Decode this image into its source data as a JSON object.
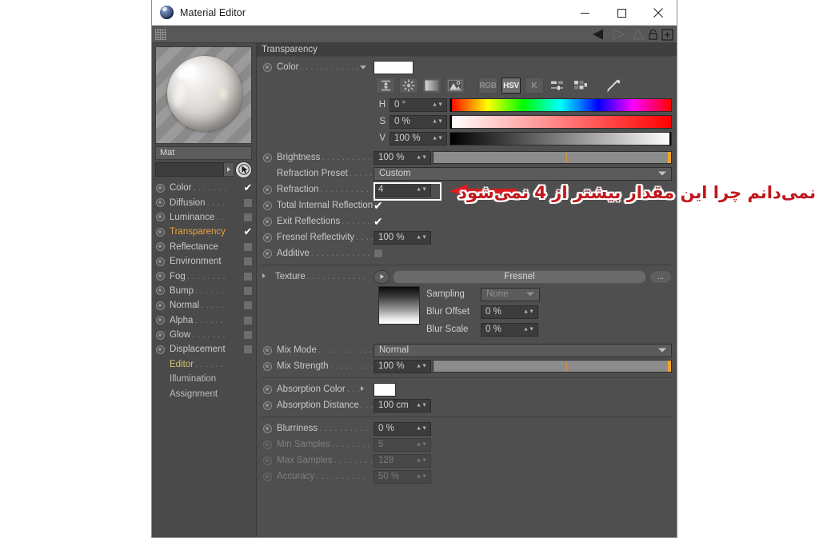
{
  "window": {
    "title": "Material Editor",
    "icon": "material-sphere-icon",
    "minimize_label": "─",
    "maximize_label": "□",
    "close_label": "✕"
  },
  "toolstrip": {
    "grip": "drag-grip",
    "icons": [
      "back-arrow-icon",
      "forward-arrow-icon",
      "up-arrow-icon",
      "lock-icon",
      "add-panel-icon"
    ]
  },
  "sidebar": {
    "material_name": "Mat",
    "name_field_value": "",
    "channels": [
      {
        "label": "Color",
        "dots": ". . . . . . .",
        "state": "checked",
        "active": false
      },
      {
        "label": "Diffusion",
        "dots": ". . . .",
        "state": "box",
        "active": false
      },
      {
        "label": "Luminance",
        "dots": ". .",
        "state": "box",
        "active": false
      },
      {
        "label": "Transparency",
        "dots": "",
        "state": "checked",
        "active": true
      },
      {
        "label": "Reflectance",
        "dots": "",
        "state": "box",
        "active": false
      },
      {
        "label": "Environment",
        "dots": "",
        "state": "box",
        "active": false
      },
      {
        "label": "Fog",
        "dots": ". . . . . . . .",
        "state": "box",
        "active": false
      },
      {
        "label": "Bump",
        "dots": ". . . . . .",
        "state": "box",
        "active": false
      },
      {
        "label": "Normal",
        "dots": ". . . . .",
        "state": "box",
        "active": false
      },
      {
        "label": "Alpha",
        "dots": ". . . . . .",
        "state": "box",
        "active": false
      },
      {
        "label": "Glow",
        "dots": ". . . . . . .",
        "state": "box",
        "active": false
      },
      {
        "label": "Displacement",
        "dots": "",
        "state": "box",
        "active": false
      }
    ],
    "extras": [
      {
        "label": "Editor",
        "dots": ". . . . . .",
        "highlight": true
      },
      {
        "label": "Illumination",
        "dots": "",
        "highlight": false
      },
      {
        "label": "Assignment",
        "dots": "",
        "highlight": false
      }
    ]
  },
  "panel": {
    "section_title": "Transparency",
    "color": {
      "label": "Color",
      "dots": ". . . . . . . . . . . .",
      "swatch": "#ffffff",
      "tools": [
        {
          "name": "eyedrop-range-icon",
          "glyph": "⧉",
          "type": "icon",
          "selected": false
        },
        {
          "name": "color-wheel-icon",
          "glyph": "✳",
          "type": "icon",
          "selected": false
        },
        {
          "name": "gradient-icon",
          "glyph": "",
          "type": "icon",
          "selected": false
        },
        {
          "name": "image-picker-icon",
          "glyph": "",
          "type": "icon",
          "selected": false
        },
        {
          "name": "rgb-mode-button",
          "glyph": "RGB",
          "type": "mode",
          "selected": false
        },
        {
          "name": "hsv-mode-button",
          "glyph": "HSV",
          "type": "mode",
          "selected": true
        },
        {
          "name": "k-mode-button",
          "glyph": "K",
          "type": "mode",
          "selected": false
        },
        {
          "name": "sliders-icon",
          "glyph": "",
          "type": "icon",
          "selected": false
        },
        {
          "name": "swatches-icon",
          "glyph": "",
          "type": "icon",
          "selected": false
        },
        {
          "name": "eyedropper-icon",
          "glyph": "",
          "type": "icon",
          "selected": false
        }
      ],
      "hsv": [
        {
          "key": "H",
          "value": "0 °",
          "bar": "hue",
          "marker_pct": 0
        },
        {
          "key": "S",
          "value": "0 %",
          "bar": "saturation",
          "marker_pct": 0
        },
        {
          "key": "V",
          "value": "100 %",
          "bar": "value",
          "marker_pct": 100
        }
      ]
    },
    "brightness": {
      "label": "Brightness",
      "dots": ". . . . . . . . . .",
      "value": "100 %",
      "slider_pct": 100
    },
    "refraction_preset": {
      "label": "Refraction Preset",
      "dots": ". . . . . .",
      "value": "Custom"
    },
    "refraction": {
      "label": "Refraction",
      "dots": ". . . . . . . . . .",
      "value": "4"
    },
    "total_internal_reflection": {
      "label": "Total Internal Reflection",
      "dots": "",
      "checked": true
    },
    "exit_reflections": {
      "label": "Exit Reflections",
      "dots": ". . . . . . .",
      "checked": true
    },
    "fresnel_reflectivity": {
      "label": "Fresnel Reflectivity",
      "dots": ". . . .",
      "value": "100 %"
    },
    "additive": {
      "label": "Additive",
      "dots": ". . . . . . . . . . . .",
      "checked": false
    },
    "texture": {
      "label": "Texture",
      "dots": ". . . . . . . . . . . .",
      "value": "Fresnel",
      "more_button": "...",
      "play_button": "play-icon",
      "thumbnail": "gradient-thumbnail",
      "sampling": {
        "label": "Sampling",
        "value": "None"
      },
      "blur_offset": {
        "label": "Blur Offset",
        "value": "0 %"
      },
      "blur_scale": {
        "label": "Blur Scale",
        "value": "0 %"
      }
    },
    "mix_mode": {
      "label": "Mix Mode",
      "dots": ". . . . . . . . . . .",
      "value": "Normal"
    },
    "mix_strength": {
      "label": "Mix Strength",
      "dots": ". . . . . . . . .",
      "value": "100 %",
      "slider_pct": 100
    },
    "absorption_color": {
      "label": "Absorption Color",
      "dots": ". . .",
      "swatch": "#ffffff"
    },
    "absorption_distance": {
      "label": "Absorption Distance",
      "dots": ". . .",
      "value": "100 cm"
    },
    "blurriness": {
      "label": "Blurriness",
      "dots": ". . . . . . . . . .",
      "value": "0 %",
      "disabled": false
    },
    "min_samples": {
      "label": "Min Samples",
      "dots": ". . . . . . . .",
      "value": "5",
      "disabled": true
    },
    "max_samples": {
      "label": "Max Samples",
      "dots": ". . . . . . . .",
      "value": "128",
      "disabled": true
    },
    "accuracy": {
      "label": "Accuracy",
      "dots": ". . . . . . . . . .",
      "value": "50 %",
      "disabled": true
    }
  },
  "annotation": {
    "text": "نمی‌دانم چرا این مقدار بیشتر از 4 نمی‌شود",
    "arrow": "red-arrow-left",
    "highlight_color": "#ffffff",
    "text_color": "#c0181d"
  }
}
